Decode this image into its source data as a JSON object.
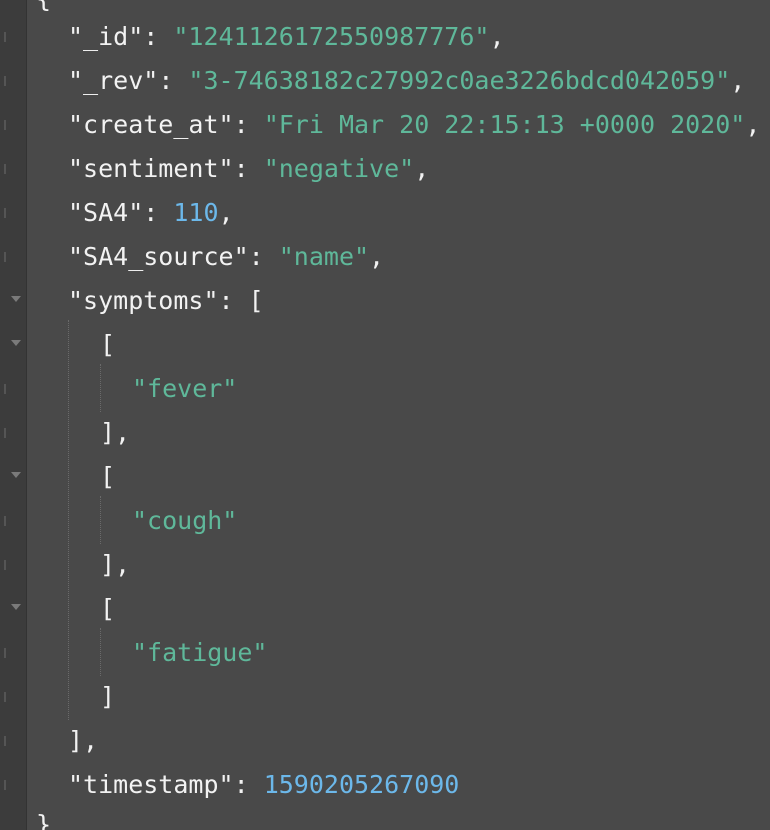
{
  "editor": {
    "open_brace": "{",
    "close_brace": "}",
    "lines": {
      "id_key": "\"_id\"",
      "id_val": "\"1241126172550987776\"",
      "rev_key": "\"_rev\"",
      "rev_val": "\"3-74638182c27992c0ae3226bdcd042059\"",
      "create_key": "\"create_at\"",
      "create_val": "\"Fri Mar 20 22:15:13 +0000 2020\"",
      "sentiment_key": "\"sentiment\"",
      "sentiment_val": "\"negative\"",
      "sa4_key": "\"SA4\"",
      "sa4_val": "110",
      "sa4src_key": "\"SA4_source\"",
      "sa4src_val": "\"name\"",
      "symptoms_key": "\"symptoms\"",
      "symptom_1": "\"fever\"",
      "symptom_2": "\"cough\"",
      "symptom_3": "\"fatigue\"",
      "timestamp_key": "\"timestamp\"",
      "timestamp_val": "1590205267090"
    }
  },
  "colors": {
    "background": "#494949",
    "key": "#f2f2f2",
    "string": "#5fb89a",
    "number": "#6cb8ea"
  }
}
